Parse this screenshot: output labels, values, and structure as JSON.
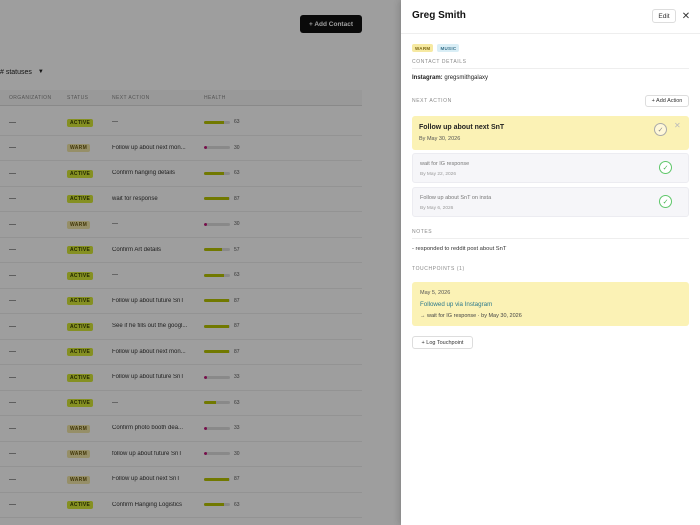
{
  "toolbar": {
    "add_contact_label": "+ Add Contact"
  },
  "filter": {
    "status_label": "# statuses"
  },
  "table": {
    "headers": [
      "ORGANIZATION",
      "STATUS",
      "NEXT ACTION",
      "HEALTH"
    ],
    "rows": [
      {
        "org": "—",
        "status": "ACTIVE",
        "next": "—",
        "health": "63",
        "level": 0.75,
        "color": "#b7c400"
      },
      {
        "org": "—",
        "status": "WARM",
        "next": "Follow up about next mon...",
        "health": "30",
        "level": 0.05,
        "color": "#c0177a"
      },
      {
        "org": "—",
        "status": "ACTIVE",
        "next": "Confirm hanging details",
        "health": "63",
        "level": 0.75,
        "color": "#b7c400"
      },
      {
        "org": "—",
        "status": "ACTIVE",
        "next": "wait for response",
        "health": "87",
        "level": 0.95,
        "color": "#b7c400"
      },
      {
        "org": "—",
        "status": "WARM",
        "next": "—",
        "health": "30",
        "level": 0.05,
        "color": "#c0177a"
      },
      {
        "org": "—",
        "status": "ACTIVE",
        "next": "Confirm Art details",
        "health": "57",
        "level": 0.7,
        "color": "#b7c400"
      },
      {
        "org": "—",
        "status": "ACTIVE",
        "next": "—",
        "health": "63",
        "level": 0.75,
        "color": "#b7c400"
      },
      {
        "org": "—",
        "status": "ACTIVE",
        "next": "Follow up about future SnT",
        "health": "87",
        "level": 0.95,
        "color": "#b7c400"
      },
      {
        "org": "—",
        "status": "ACTIVE",
        "next": "See if he fills out the googl...",
        "health": "87",
        "level": 0.95,
        "color": "#b7c400"
      },
      {
        "org": "—",
        "status": "ACTIVE",
        "next": "Follow up about next mon...",
        "health": "87",
        "level": 0.95,
        "color": "#b7c400"
      },
      {
        "org": "—",
        "status": "ACTIVE",
        "next": "Follow up about future SnT",
        "health": "33",
        "level": 0.05,
        "color": "#c0177a"
      },
      {
        "org": "—",
        "status": "ACTIVE",
        "next": "—",
        "health": "63",
        "level": 0.45,
        "color": "#b7c400"
      },
      {
        "org": "—",
        "status": "WARM",
        "next": "Confirm photo booth dea...",
        "health": "33",
        "level": 0.05,
        "color": "#c0177a"
      },
      {
        "org": "—",
        "status": "WARM",
        "next": "follow up about future SnT",
        "health": "30",
        "level": 0.05,
        "color": "#c0177a"
      },
      {
        "org": "—",
        "status": "WARM",
        "next": "Follow up about next SnT",
        "health": "87",
        "level": 0.95,
        "color": "#b7c400"
      },
      {
        "org": "—",
        "status": "ACTIVE",
        "next": "Confirm Hanging Logistics",
        "health": "63",
        "level": 0.75,
        "color": "#b7c400"
      }
    ]
  },
  "drawer": {
    "title": "Greg Smith",
    "edit_label": "Edit",
    "close_glyph": "✕",
    "tags": [
      "WARM",
      "MUSIC"
    ],
    "contact_details_label": "CONTACT DETAILS",
    "instagram_label": "Instagram:",
    "instagram_value": "gregsmithgalaxy",
    "next_action_label": "NEXT ACTION",
    "add_action_label": "+ Add Action",
    "actions": [
      {
        "title": "Follow up about next SnT",
        "date": "By May 30, 2026"
      },
      {
        "title": "wait for IG response",
        "date": "By May 22, 2026"
      },
      {
        "title": "Follow up about SnT on insta",
        "date": "By May 6, 2026"
      }
    ],
    "notes_label": "NOTES",
    "notes_text": "- responded to reddit post about SnT",
    "touchpoints_label": "TOUCHPOINTS (1)",
    "touchpoint": {
      "date": "May 5, 2026",
      "title": "Followed up via Instagram",
      "sub": "→ wait for IG response · by May 30, 2026"
    },
    "log_touchpoint_label": "+ Log Touchpoint"
  }
}
